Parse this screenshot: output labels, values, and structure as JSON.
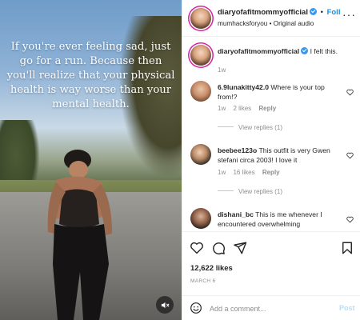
{
  "media": {
    "caption": "If you're ever feeling sad, just go for a run. Because then you'll realize that your physical health is way worse than your mental health.",
    "mute_icon": "speaker-muted-icon"
  },
  "header": {
    "username": "diaryofafitmommyofficial",
    "separator": "•",
    "follow_label": "Foll",
    "subtitle": "mumhacksforyou • Original audio",
    "more_icon": "more-horizontal-icon"
  },
  "caption_comment": {
    "username": "diaryofafitmommyofficial",
    "text": "I felt this.",
    "age": "1w"
  },
  "comments": [
    {
      "username": "6.9lunakitty42.0",
      "text": "Where is your top from!?",
      "age": "1w",
      "likes": "2 likes",
      "reply_label": "Reply",
      "view_replies": "View replies (1)"
    },
    {
      "username": "beebee123o",
      "text": "This outfit is very Gwen stefani circa 2003! I love it",
      "age": "1w",
      "likes": "16 likes",
      "reply_label": "Reply",
      "view_replies": "View replies (1)"
    },
    {
      "username": "dishani_bc",
      "text": "This is me whenever I encountered overwhelming"
    }
  ],
  "actions": {
    "likes": "12,622 likes",
    "date": "MARCH 6"
  },
  "composer": {
    "placeholder": "Add a comment...",
    "post_label": "Post"
  },
  "colors": {
    "accent": "#0095f6",
    "verified": "#3897f0",
    "muted_text": "#8e8e8e",
    "post_disabled": "#b2dffc"
  }
}
